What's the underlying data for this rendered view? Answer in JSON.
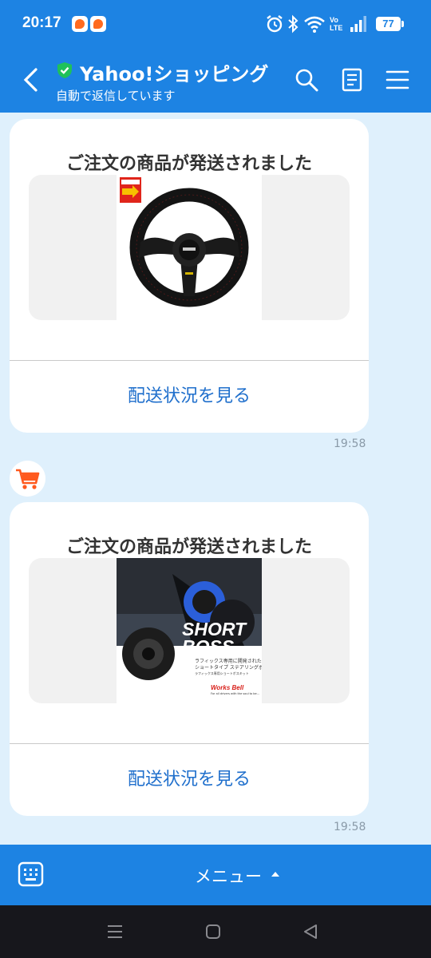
{
  "status_bar": {
    "time": "20:17",
    "network_label": "Vo LTE",
    "battery": "77"
  },
  "header": {
    "title": "Yahoo!ショッピング",
    "subtitle": "自動で返信しています"
  },
  "messages": [
    {
      "title": "ご注文の商品が発送されました",
      "button_label": "配送状況を見る",
      "time": "19:58",
      "image": "steering-wheel"
    },
    {
      "title": "ご注文の商品が発送されました",
      "button_label": "配送状況を見る",
      "time": "19:58",
      "image": "short-boss-kit",
      "image_text": {
        "headline": "SHORT BOSS",
        "line1": "ラフィックス専用に開発された",
        "line2": "ショートタイプ ステアリングボス",
        "line3": "ラフィックス専用ショートボスキット",
        "brand": "Works Bell",
        "tagline": "For all drivers with the soul to be..."
      }
    }
  ],
  "menu_bar": {
    "label": "メニュー"
  },
  "colors": {
    "brand_blue": "#1d83e3",
    "chat_bg": "#dff0fc",
    "link_blue": "#1f6fcc",
    "verified_green": "#1fc15a"
  }
}
